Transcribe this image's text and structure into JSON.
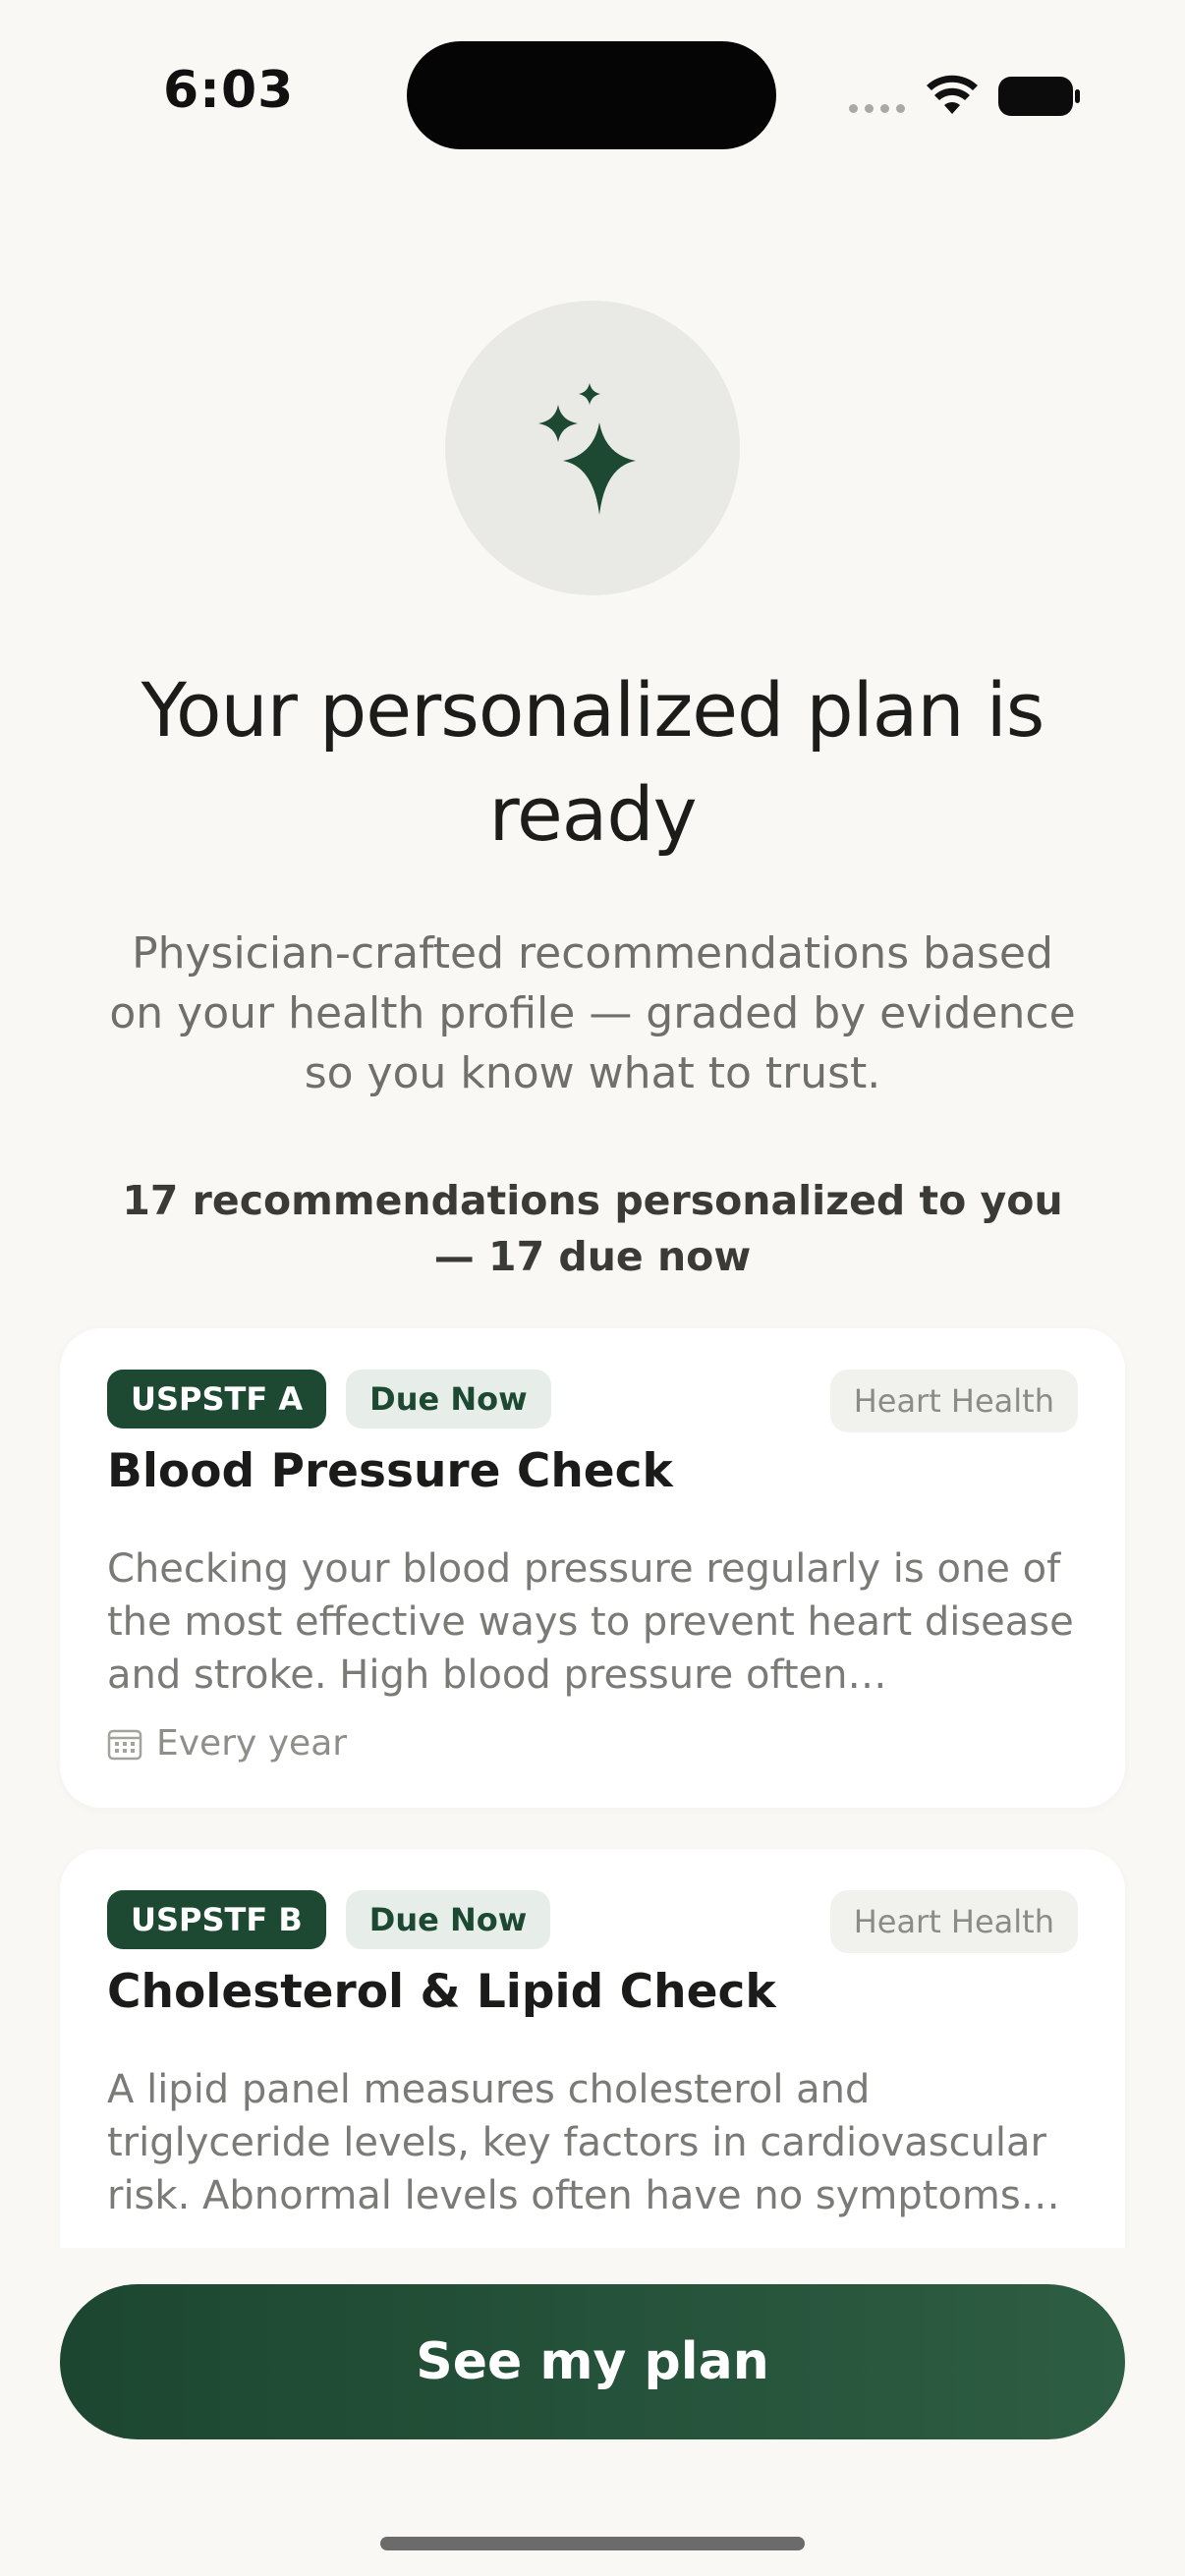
{
  "status_bar": {
    "time": "6:03",
    "wifi_icon": "wifi-icon",
    "battery_icon": "battery-icon"
  },
  "hero": {
    "icon": "sparkles-icon",
    "icon_color": "#1d4932",
    "title": "Your personalized plan is ready",
    "subtitle": "Physician-crafted recommendations based on your health profile — graded by evidence so you know what to trust.",
    "summary": "17 recommendations personalized to you — 17 due now"
  },
  "recommendations": [
    {
      "grade": "USPSTF A",
      "status": "Due Now",
      "category": "Heart Health",
      "title": "Blood Pressure Check",
      "description": "Checking your blood pressure regularly is one of the most effective ways to prevent heart disease and stroke. High blood pressure often…",
      "frequency": "Every year",
      "frequency_icon": "calendar-icon"
    },
    {
      "grade": "USPSTF B",
      "status": "Due Now",
      "category": "Heart Health",
      "title": "Cholesterol & Lipid Check",
      "description": "A lipid panel measures cholesterol and triglyceride levels, key factors in cardiovascular risk. Abnormal levels often have no symptoms…"
    }
  ],
  "cta": {
    "label": "See my plan"
  },
  "colors": {
    "background": "#f9f8f5",
    "brand_green": "#1d4932",
    "due_badge_bg": "#e7eee9",
    "category_chip_bg": "#f1f1ee"
  }
}
